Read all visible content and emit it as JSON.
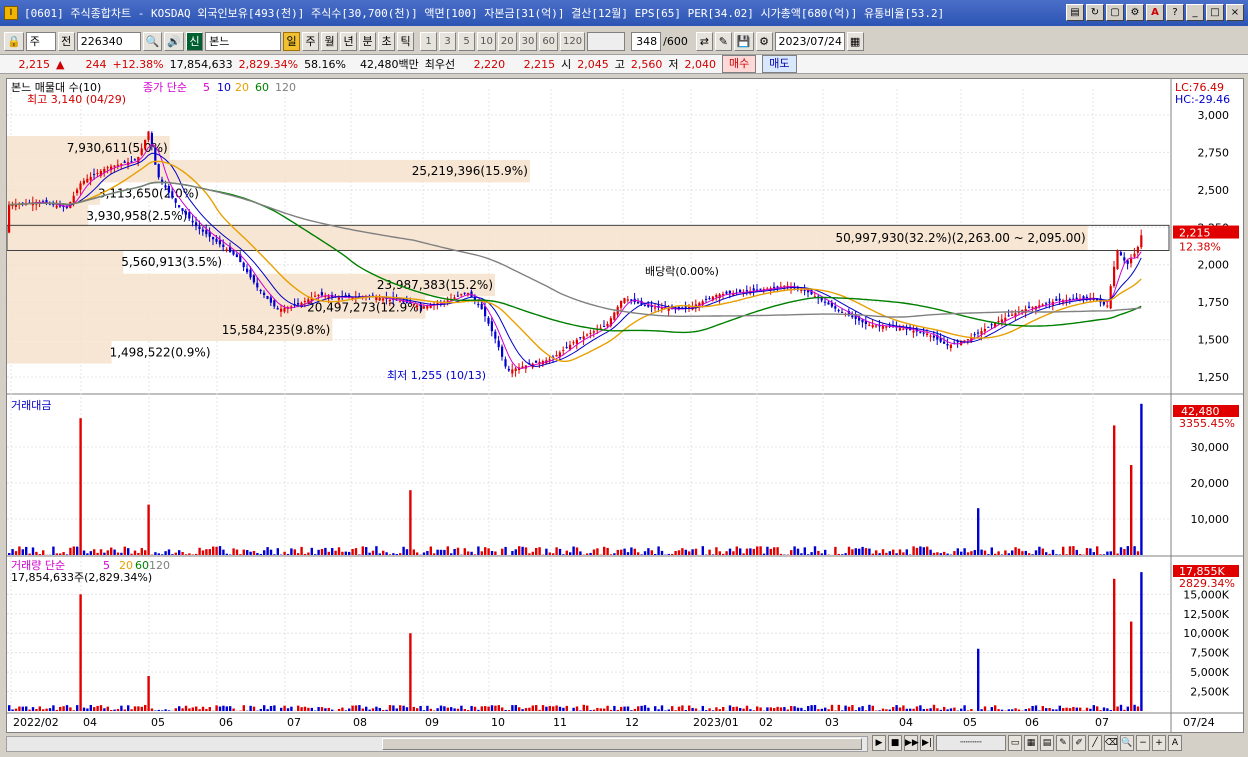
{
  "window": {
    "title": "[0601] 주식종합차트 - KOSDAQ 외국인보유[493(천)] 주식수[30,700(천)] 액면[100] 자본금[31(억)] 결산[12월] EPS[65] PER[34.02] 시가총액[680(억)] 유통비율[53.2]",
    "app_icon": "I",
    "controls": [
      "icon-a",
      "icon-b",
      "icon-c",
      "icon-d",
      "A",
      "?",
      "_",
      "□",
      "×"
    ]
  },
  "toolbar": {
    "market": "주",
    "all_label": "전",
    "code": "226340",
    "flag": "신",
    "stock_name": "본느",
    "period_buttons": [
      "일",
      "주",
      "월",
      "년",
      "분",
      "초",
      "틱"
    ],
    "active_period": "일",
    "interval_buttons": [
      "1",
      "3",
      "5",
      "10",
      "20",
      "30",
      "60",
      "120"
    ],
    "count": "348",
    "count_total": "/600",
    "date": "2023/07/24"
  },
  "quote": {
    "price": "2,215",
    "change": "244",
    "change_pct": "+12.38%",
    "volume": "17,854,633",
    "volume_pct": "2,829.34%",
    "ratio": "58.16%",
    "amount": "42,480백만",
    "best_label": "최우선",
    "ask": "2,220",
    "bid": "2,215",
    "open_label": "시",
    "open": "2,045",
    "high_label": "고",
    "high": "2,560",
    "low_label": "저",
    "low": "2,040",
    "buy_label": "매수",
    "sell_label": "매도"
  },
  "price_panel": {
    "legend_name": "본느 매물대 수(10)",
    "legend_ma": "종가 단순",
    "ma_periods": [
      "5",
      "10",
      "20",
      "60",
      "120"
    ],
    "ma_colors": [
      "#d000d0",
      "#0000c8",
      "#e8a000",
      "#008000",
      "#808080"
    ],
    "lc": "LC:76.49",
    "hc": "HC:-29.46",
    "y_ticks": [
      "3,000",
      "2,750",
      "2,500",
      "2,250",
      "2,000",
      "1,750",
      "1,500",
      "1,250"
    ],
    "current_price_tag": "2,215",
    "current_pct_tag": "12.38%",
    "high_annot": "최고 3,140 (04/29)",
    "low_annot": "최저 1,255 (10/13)",
    "dividend_annot": "배당락(0.00%)",
    "volume_profile": [
      {
        "label": "7,930,611(5.0%)",
        "low": 2700,
        "high": 2860,
        "width": 0.14
      },
      {
        "label": "25,219,396(15.9%)",
        "low": 2550,
        "high": 2700,
        "width": 0.45
      },
      {
        "label": "3,113,650(2.0%)",
        "low": 2400,
        "high": 2550,
        "width": 0.08
      },
      {
        "label": "3,930,958(2.5%)",
        "low": 2250,
        "high": 2400,
        "width": 0.07
      },
      {
        "label": "50,997,930(32.2%)(2,263.00 ~ 2,095.00)",
        "low": 2095,
        "high": 2263,
        "width": 0.93
      },
      {
        "label": "5,560,913(3.5%)",
        "low": 1940,
        "high": 2095,
        "width": 0.1
      },
      {
        "label": "23,987,383(15.2%)",
        "low": 1790,
        "high": 1940,
        "width": 0.42
      },
      {
        "label": "20,497,273(12.9%)",
        "low": 1640,
        "high": 1790,
        "width": 0.36
      },
      {
        "label": "15,584,235(9.8%)",
        "low": 1490,
        "high": 1640,
        "width": 0.28
      },
      {
        "label": "1,498,522(0.9%)",
        "low": 1340,
        "high": 1490,
        "width": 0.09
      }
    ]
  },
  "amount_panel": {
    "title": "거래대금",
    "y_ticks": [
      "30,000",
      "20,000",
      "10,000"
    ],
    "tag": "42,480",
    "tag_pct": "3355.45%"
  },
  "volume_panel": {
    "title": "거래량 단순",
    "ma_periods": [
      "5",
      "20",
      "60",
      "120"
    ],
    "ma_colors": [
      "#d000d0",
      "#e8a000",
      "#008000",
      "#808080"
    ],
    "value_text": "17,854,633주(2,829.34%)",
    "y_ticks": [
      "15,000K",
      "12,500K",
      "10,000K",
      "7,500K",
      "5,000K",
      "2,500K"
    ],
    "tag": "17,855K",
    "tag_pct": "2829.34%"
  },
  "x_axis": {
    "labels": [
      "2022/02",
      "04",
      "05",
      "06",
      "07",
      "08",
      "09",
      "10",
      "11",
      "12",
      "2023/01",
      "02",
      "03",
      "04",
      "05",
      "06",
      "07"
    ],
    "right_label": "07/24"
  },
  "statusbar": {
    "nav": [
      "▶",
      "■",
      "▶▶",
      "▶|"
    ],
    "zoom": [
      "−",
      "+",
      "A"
    ]
  }
}
